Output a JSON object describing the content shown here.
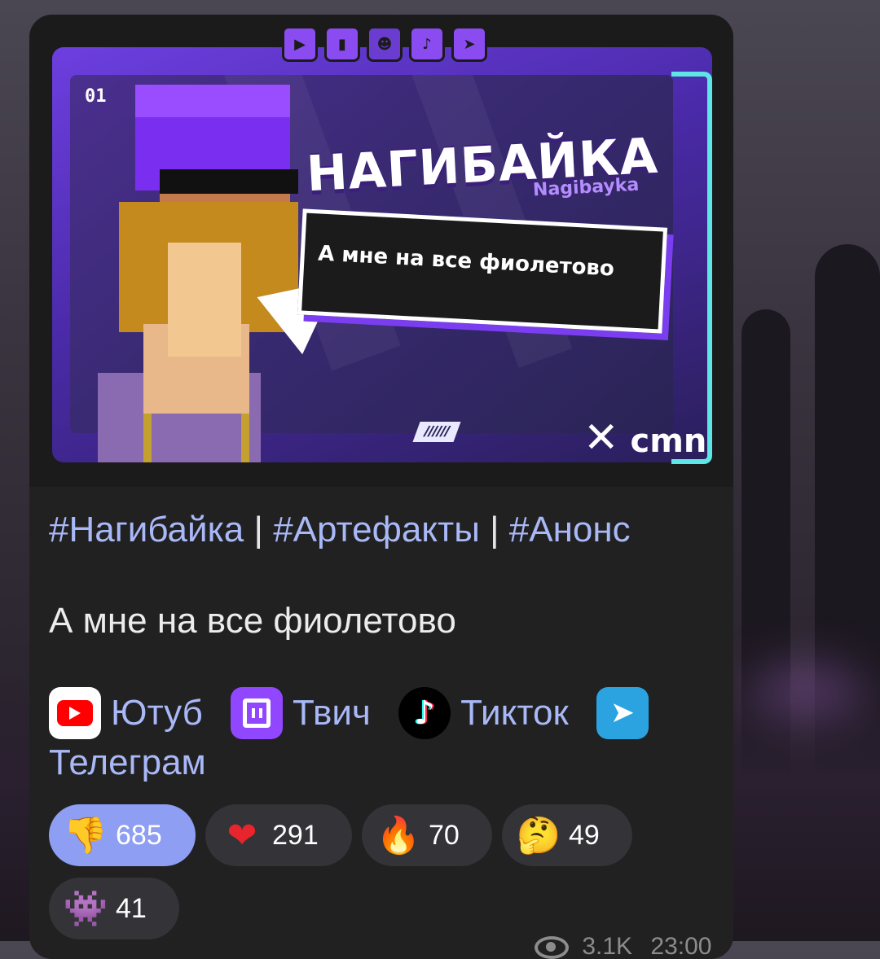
{
  "banner": {
    "episode_tag": "01",
    "title": "НАГИБАЙКА",
    "subtitle": "Nagibayka",
    "bubble_text": "А мне на все фиолетово",
    "brand": "cmn",
    "social_icons": [
      "youtube-icon",
      "twitch-icon",
      "avatar-icon",
      "tiktok-icon",
      "telegram-icon"
    ]
  },
  "post": {
    "hashtags": [
      "#Нагибайка",
      "#Артефакты",
      "#Анонс"
    ],
    "separator": "|",
    "text": "А мне на все фиолетово",
    "links": [
      {
        "label": "Ютуб",
        "icon": "youtube-icon"
      },
      {
        "label": "Твич",
        "icon": "twitch-icon"
      },
      {
        "label": "Тикток",
        "icon": "tiktok-icon"
      },
      {
        "label": "Телеграм",
        "icon": "telegram-icon"
      }
    ]
  },
  "reactions": [
    {
      "emoji": "👎",
      "count": "685",
      "active": true
    },
    {
      "emoji": "❤",
      "count": "291",
      "active": false
    },
    {
      "emoji": "🔥",
      "count": "70",
      "active": false
    },
    {
      "emoji": "🤔",
      "count": "49",
      "active": false
    },
    {
      "emoji": "👾",
      "count": "41",
      "active": false
    }
  ],
  "meta": {
    "views": "3.1K",
    "time": "23:00"
  },
  "colors": {
    "link": "#a9b8f7",
    "card_bg": "#212121",
    "active_reaction": "#8d9ef3",
    "reaction_bg": "#333338"
  }
}
